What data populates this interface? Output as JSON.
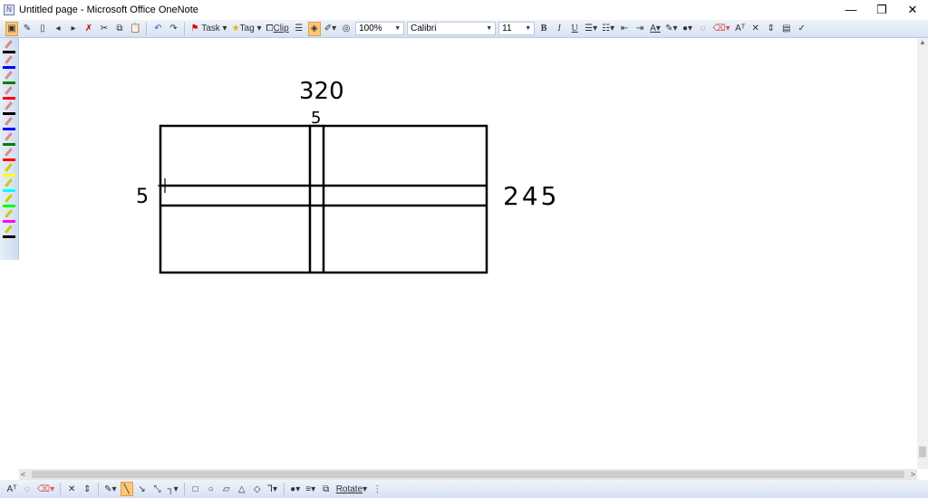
{
  "window": {
    "title": "Untitled page - Microsoft Office OneNote",
    "minimize": "—",
    "restore": "❐",
    "close": "✕"
  },
  "toolbar": {
    "task_label": "Task",
    "tag_label": "Tag",
    "clip_label": "Clip",
    "zoom": "100%",
    "font": "Calibri",
    "font_size": "11",
    "bold": "B",
    "italic": "I",
    "underline": "U"
  },
  "pens": {
    "colors": [
      "#000000",
      "#0000ff",
      "#008000",
      "#ff0000",
      "#000000",
      "#0000ff",
      "#008000",
      "#ff0000",
      "#ffff00",
      "#00ffff",
      "#00ff00",
      "#ff00ff",
      "#000000"
    ]
  },
  "canvas": {
    "label_top": "320",
    "label_top_gap": "5",
    "label_left_gap": "5",
    "label_right": "245"
  },
  "drawing_toolbar": {
    "rotate_label": "Rotate"
  }
}
